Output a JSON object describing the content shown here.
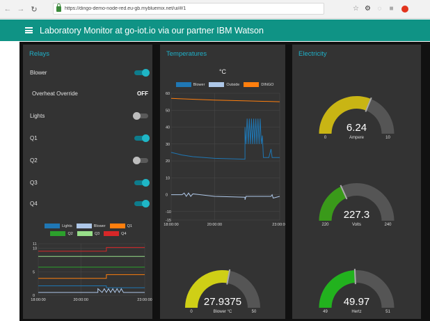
{
  "browser": {
    "url": "https://dingo-demo-node-red.eu-gb.mybluemix.net/ui/#/1",
    "icons": [
      "back-icon",
      "forward-icon",
      "reload-icon",
      "lock-icon",
      "star-icon",
      "extension-icon",
      "opera-icon"
    ]
  },
  "app": {
    "title": "Laboratory Monitor at go-iot.io via our partner IBM Watson"
  },
  "colors": {
    "header": "#0f9385",
    "accent": "#1fb0c8",
    "card": "#333333",
    "background": "#111111"
  },
  "relays": {
    "title": "Relays",
    "items": [
      {
        "label": "Blower",
        "type": "switch",
        "on": true
      },
      {
        "label": "Overheat Override",
        "type": "text",
        "value": "OFF"
      },
      {
        "label": "Lights",
        "type": "switch",
        "on": false
      },
      {
        "label": "Q1",
        "type": "switch",
        "on": true
      },
      {
        "label": "Q2",
        "type": "switch",
        "on": false
      },
      {
        "label": "Q3",
        "type": "switch",
        "on": true
      },
      {
        "label": "Q4",
        "type": "switch",
        "on": true
      }
    ]
  },
  "temperatures": {
    "title": "Temperatures"
  },
  "electricity": {
    "title": "Electricity"
  },
  "chart_data": [
    {
      "type": "line",
      "title": "",
      "categories_x": [
        "18:00:00",
        "20:00:00",
        "23:00:00"
      ],
      "x_range": [
        18,
        23
      ],
      "ylim": [
        0,
        11
      ],
      "yticks": [
        0,
        5,
        10,
        11
      ],
      "grid": true,
      "legend": "top",
      "series": [
        {
          "name": "Lights",
          "color": "#1f77b4",
          "points": [
            [
              18,
              2.0
            ],
            [
              21.2,
              2.0
            ],
            [
              21.2,
              1.6
            ],
            [
              23,
              1.6
            ]
          ]
        },
        {
          "name": "Blower",
          "color": "#aec7e8",
          "points": [
            [
              18,
              0.6
            ],
            [
              20.8,
              0.6
            ],
            [
              20.8,
              1.4
            ],
            [
              21.0,
              0.6
            ],
            [
              21.1,
              1.4
            ],
            [
              21.2,
              0.6
            ],
            [
              21.3,
              1.4
            ],
            [
              21.4,
              0.6
            ],
            [
              21.5,
              1.4
            ],
            [
              21.6,
              0.6
            ],
            [
              21.7,
              1.4
            ],
            [
              21.8,
              0.6
            ],
            [
              21.9,
              1.4
            ],
            [
              22.0,
              0.6
            ],
            [
              23,
              0.6
            ]
          ]
        },
        {
          "name": "Q1",
          "color": "#ff7f0e",
          "points": [
            [
              18,
              3.6
            ],
            [
              21.2,
              3.6
            ],
            [
              21.2,
              4.4
            ],
            [
              23,
              4.4
            ]
          ]
        },
        {
          "name": "Q2",
          "color": "#2ca02c",
          "points": [
            [
              18,
              6.0
            ],
            [
              23,
              6.0
            ]
          ]
        },
        {
          "name": "Q3",
          "color": "#98df8a",
          "points": [
            [
              18,
              8.3
            ],
            [
              23,
              8.3
            ]
          ]
        },
        {
          "name": "Q4",
          "color": "#d62728",
          "points": [
            [
              18,
              9.4
            ],
            [
              21.2,
              9.4
            ],
            [
              21.2,
              10.2
            ],
            [
              23,
              10.2
            ]
          ]
        }
      ]
    },
    {
      "type": "line",
      "title": "°C",
      "categories_x": [
        "18:00:00",
        "20:00:00",
        "23:00:00"
      ],
      "x_range": [
        18,
        23
      ],
      "ylim": [
        -15,
        60
      ],
      "yticks": [
        60,
        50,
        40,
        30,
        20,
        10,
        0,
        -10,
        -15
      ],
      "grid": true,
      "legend": "top",
      "series": [
        {
          "name": "Blower",
          "color": "#1f77b4",
          "points": [
            [
              18,
              25
            ],
            [
              18.5,
              23.5
            ],
            [
              19,
              22.5
            ],
            [
              20,
              21.5
            ],
            [
              21.4,
              21
            ],
            [
              21.4,
              40
            ],
            [
              21.45,
              30
            ],
            [
              21.5,
              45
            ],
            [
              21.55,
              30
            ],
            [
              21.6,
              45
            ],
            [
              21.65,
              30
            ],
            [
              21.7,
              45
            ],
            [
              21.75,
              30
            ],
            [
              21.8,
              45
            ],
            [
              21.85,
              30
            ],
            [
              21.9,
              45
            ],
            [
              21.95,
              30
            ],
            [
              22.0,
              45
            ],
            [
              22.05,
              30
            ],
            [
              22.1,
              45
            ],
            [
              22.15,
              30
            ],
            [
              22.2,
              35
            ],
            [
              22.25,
              22
            ],
            [
              22.5,
              22
            ],
            [
              22.6,
              27
            ],
            [
              22.65,
              22
            ],
            [
              23,
              22
            ]
          ]
        },
        {
          "name": "Outside",
          "color": "#aec7e8",
          "points": [
            [
              18,
              0
            ],
            [
              18.5,
              0
            ],
            [
              18.6,
              1
            ],
            [
              18.7,
              -1
            ],
            [
              18.8,
              1
            ],
            [
              18.9,
              -1
            ],
            [
              19.0,
              0.5
            ],
            [
              20,
              -1
            ],
            [
              21.4,
              -1.5
            ],
            [
              21.4,
              -3
            ],
            [
              21.45,
              -1
            ],
            [
              22.6,
              -1
            ],
            [
              22.65,
              0
            ],
            [
              22.7,
              -2
            ],
            [
              23,
              -1
            ]
          ]
        },
        {
          "name": "DINGO",
          "color": "#ff7f0e",
          "points": [
            [
              18,
              57
            ],
            [
              20,
              56
            ],
            [
              21.5,
              55.5
            ],
            [
              23,
              55
            ]
          ]
        }
      ]
    }
  ],
  "gauges": [
    {
      "id": "temp",
      "value": "27.9375",
      "num": 27.9375,
      "min": 0,
      "max": 50,
      "min_label": "0",
      "max_label": "50",
      "unit": "Blower °C",
      "color": "#cfcf16"
    },
    {
      "id": "amps",
      "value": "6.24",
      "num": 6.24,
      "min": 0,
      "max": 10,
      "min_label": "0",
      "max_label": "10",
      "unit": "Ampere",
      "color": "#c9b514"
    },
    {
      "id": "volts",
      "value": "227.3",
      "num": 227.3,
      "min": 220,
      "max": 240,
      "min_label": "220",
      "max_label": "240",
      "unit": "Volts",
      "color": "#3a9a1a"
    },
    {
      "id": "hertz",
      "value": "49.97",
      "num": 49.97,
      "min": 49,
      "max": 51,
      "min_label": "49",
      "max_label": "51",
      "unit": "Hertz",
      "color": "#22b21e"
    }
  ]
}
